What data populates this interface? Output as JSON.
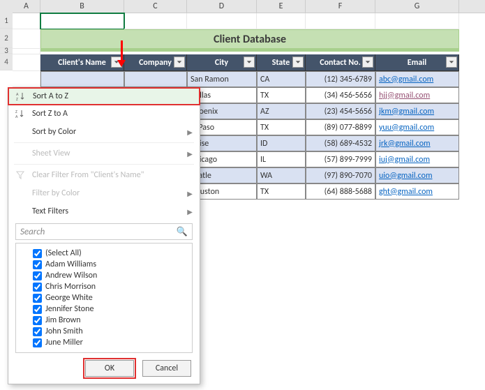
{
  "cols": [
    "A",
    "B",
    "C",
    "D",
    "E",
    "F",
    "G"
  ],
  "title": "Client Database",
  "headers": {
    "name": "Client's Name",
    "company": "Company",
    "city": "City",
    "state": "State",
    "contact": "Contact No.",
    "email": "Email"
  },
  "rows": [
    {
      "city": "San Ramon",
      "state": "CA",
      "contact": "(12) 345-6789",
      "email": "abc@gmail.com"
    },
    {
      "city": "Dallas",
      "state": "TX",
      "contact": "(34) 456-5656",
      "email": "hjj@gmail.com"
    },
    {
      "city": "Phoenix",
      "state": "AZ",
      "contact": "(23) 454-5656",
      "email": "jkm@gmail.com"
    },
    {
      "city": "El Paso",
      "state": "TX",
      "contact": "(89) 077-8899",
      "email": "yuu@gmail.com"
    },
    {
      "city": "Boise",
      "state": "ID",
      "contact": "(58) 689-4532",
      "email": "jrk@gmail.com"
    },
    {
      "city": "Chicago",
      "state": "IL",
      "contact": "(57) 899-7999",
      "email": "iuj@gmail.com"
    },
    {
      "city": "Seatle",
      "state": "WA",
      "contact": "(97) 890-7070",
      "email": "uio@gmail.com"
    },
    {
      "city": "Houston",
      "state": "TX",
      "contact": "(64) 888-5688",
      "email": "ght@gmail.com"
    }
  ],
  "menu": {
    "sortAZ": "Sort A to Z",
    "sortZA": "Sort Z to A",
    "sortColor": "Sort by Color",
    "sheetView": "Sheet View",
    "clearFilter": "Clear Filter From \"Client's Name\"",
    "filterColor": "Filter by Color",
    "textFilters": "Text Filters",
    "searchPlaceholder": "Search",
    "ok": "OK",
    "cancel": "Cancel"
  },
  "checks": [
    "(Select All)",
    "Adam Williams",
    "Andrew Wilson",
    "Chris Morrison",
    "George White",
    "Jennifer Stone",
    "Jim Brown",
    "John Smith",
    "June Miller"
  ]
}
